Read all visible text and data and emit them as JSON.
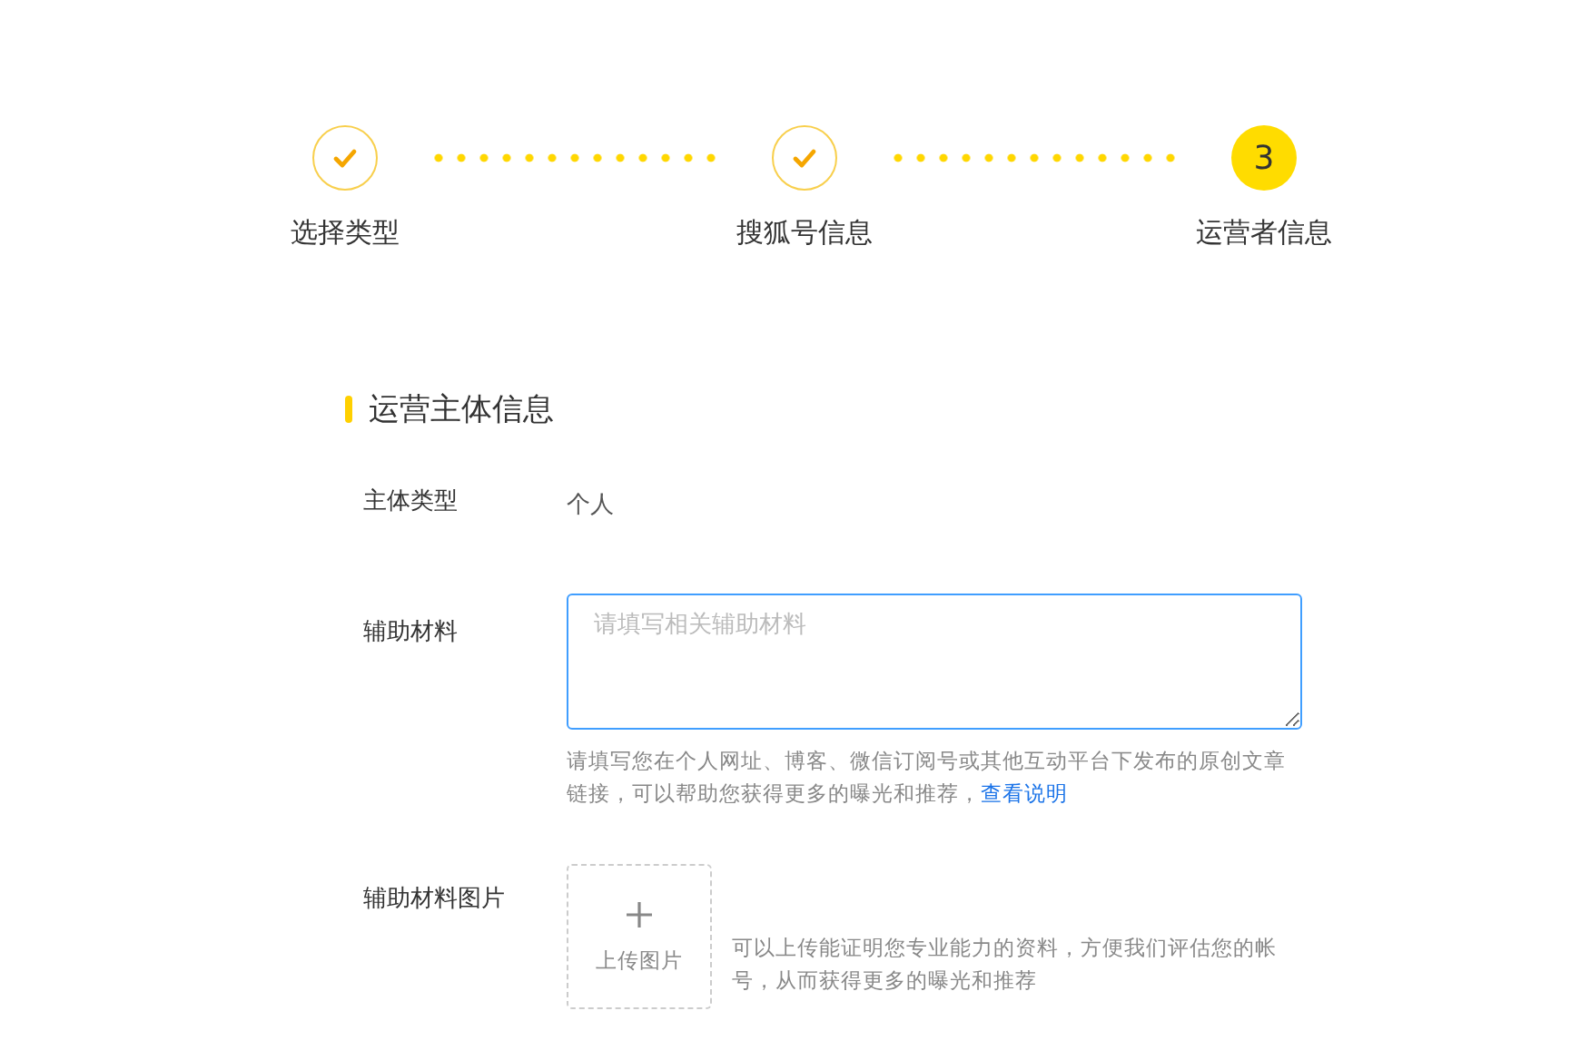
{
  "steps": [
    {
      "label": "选择类型",
      "kind": "done"
    },
    {
      "label": "搜狐号信息",
      "kind": "done"
    },
    {
      "label": "运营者信息",
      "kind": "current",
      "number": "3"
    }
  ],
  "section": {
    "title": "运营主体信息"
  },
  "fields": [
    {
      "kind": "text",
      "label": "主体类型",
      "value": "个人"
    },
    {
      "kind": "textarea",
      "label": "辅助材料",
      "placeholder": "请填写相关辅助材料",
      "focused": true,
      "help": "请填写您在个人网址、博客、微信订阅号或其他互动平台下发布的原创文章链接，可以帮助您获得更多的曝光和推荐，",
      "help_link": "查看说明"
    },
    {
      "kind": "upload",
      "label": "辅助材料图片",
      "button": "上传图片",
      "help": "可以上传能证明您专业能力的资料，方便我们评估您的帐号，从而获得更多的曝光和推荐"
    }
  ]
}
